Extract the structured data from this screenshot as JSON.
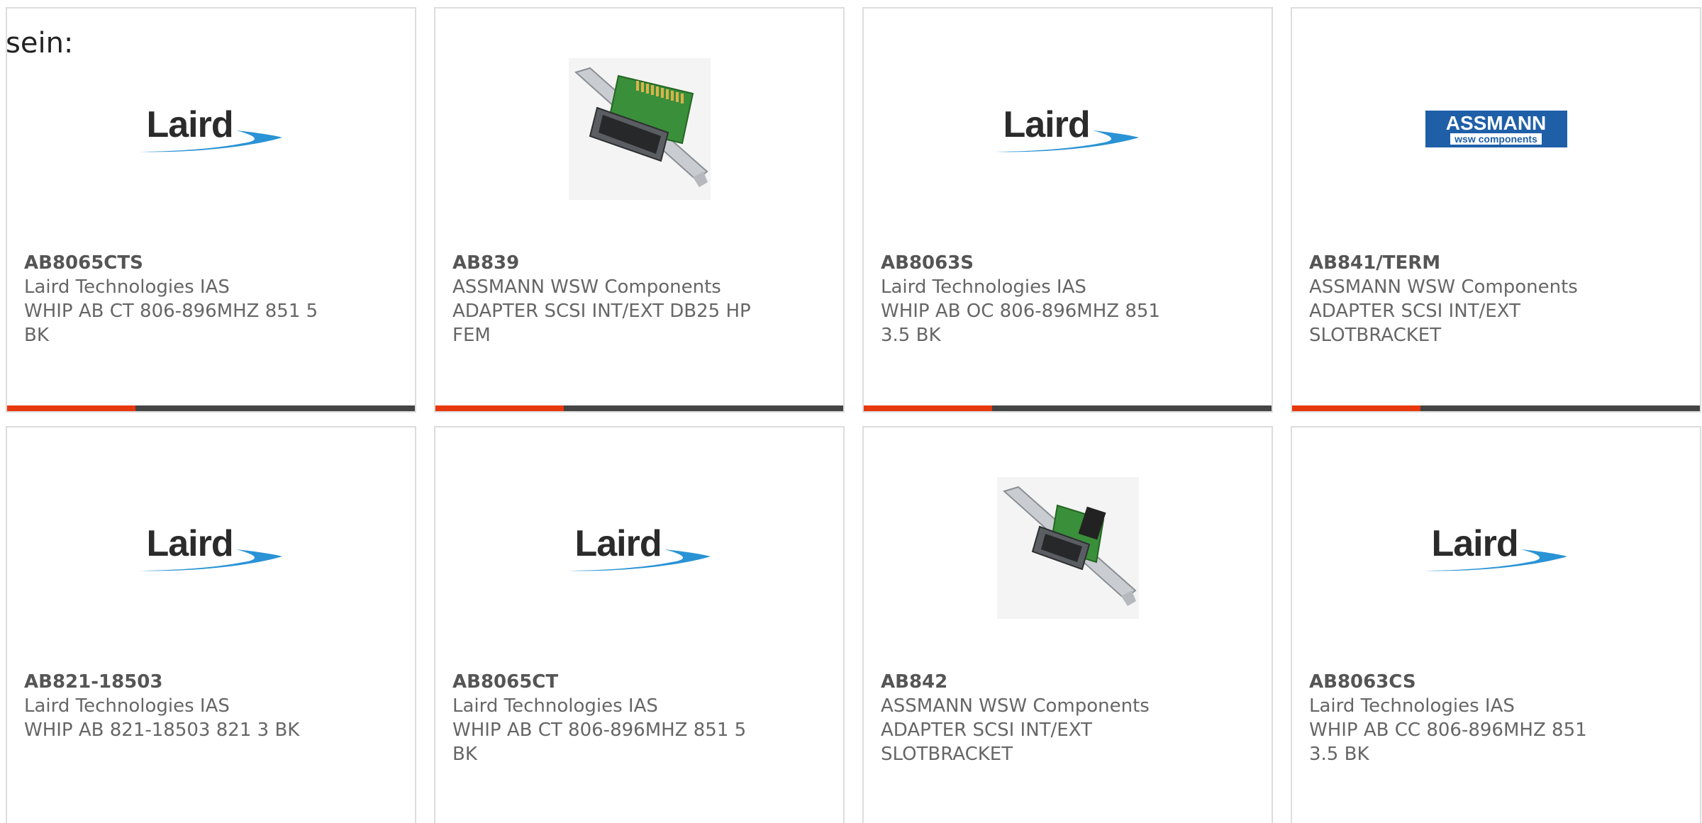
{
  "lead_text": "sein:",
  "colors": {
    "accent_bar": "#e8380d",
    "bar_dark": "#444444",
    "card_border": "#dddddd",
    "text": "#666666",
    "laird_swoosh": "#2a93d5",
    "assmann_blue": "#1e5fa8"
  },
  "logos": {
    "laird": "Laird",
    "assmann_main": "ASSMANN",
    "assmann_sub": "wsw components"
  },
  "products": [
    {
      "part": "AB8065CTS",
      "manufacturer": "Laird Technologies IAS",
      "description": "WHIP AB CT 806-896MHZ 851 5 BK",
      "image": "laird-logo"
    },
    {
      "part": "AB839",
      "manufacturer": "ASSMANN WSW Components",
      "description": "ADAPTER SCSI INT/EXT DB25 HP FEM",
      "image": "scsi-bracket-photo"
    },
    {
      "part": "AB8063S",
      "manufacturer": "Laird Technologies IAS",
      "description": "WHIP AB OC 806-896MHZ 851 3.5 BK",
      "image": "laird-logo"
    },
    {
      "part": "AB841/TERM",
      "manufacturer": "ASSMANN WSW Components",
      "description": "ADAPTER SCSI INT/EXT SLOTBRACKET",
      "image": "assmann-logo"
    },
    {
      "part": "AB821-18503",
      "manufacturer": "Laird Technologies IAS",
      "description": "WHIP AB 821-18503 821 3 BK",
      "image": "laird-logo"
    },
    {
      "part": "AB8065CT",
      "manufacturer": "Laird Technologies IAS",
      "description": "WHIP AB CT 806-896MHZ 851 5 BK",
      "image": "laird-logo"
    },
    {
      "part": "AB842",
      "manufacturer": "ASSMANN WSW Components",
      "description": "ADAPTER SCSI INT/EXT SLOTBRACKET",
      "image": "scsi-bracket-photo"
    },
    {
      "part": "AB8063CS",
      "manufacturer": "Laird Technologies IAS",
      "description": "WHIP AB CC 806-896MHZ 851 3.5 BK",
      "image": "laird-logo"
    }
  ]
}
